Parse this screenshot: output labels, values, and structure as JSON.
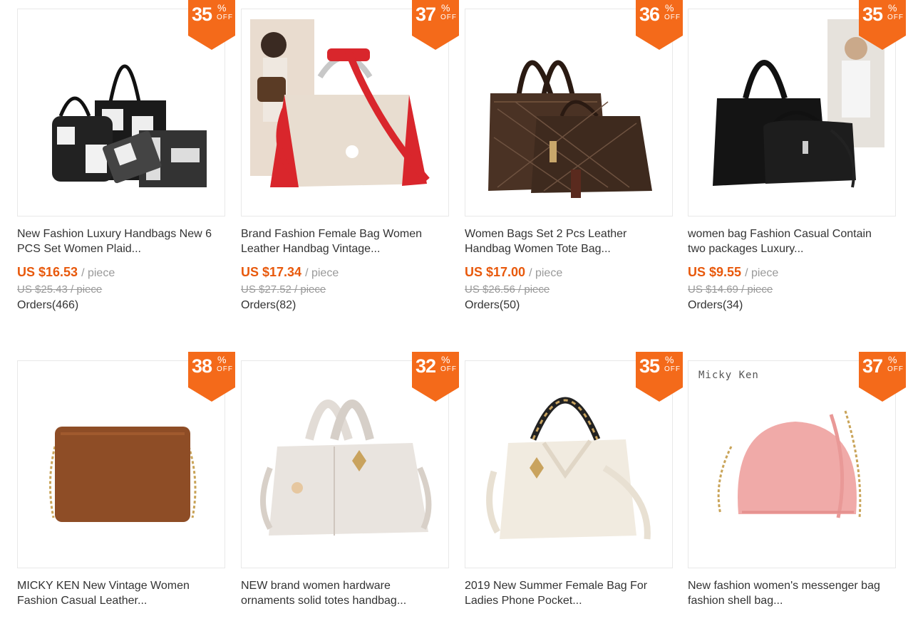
{
  "products": [
    {
      "discount": "35",
      "pct": "%",
      "off": "OFF",
      "title_l1": "New Fashion Luxury Handbags New 6",
      "title_l2": "PCS Set Women Plaid...",
      "price": "US $16.53",
      "unit": "/ piece",
      "orig": "US $25.43 / piece",
      "orders": "Orders(466)"
    },
    {
      "discount": "37",
      "pct": "%",
      "off": "OFF",
      "title_l1": "Brand Fashion Female Bag Women",
      "title_l2": "Leather Handbag Vintage...",
      "price": "US $17.34",
      "unit": "/ piece",
      "orig": "US $27.52 / piece",
      "orders": "Orders(82)"
    },
    {
      "discount": "36",
      "pct": "%",
      "off": "OFF",
      "title_l1": "Women Bags Set 2 Pcs Leather",
      "title_l2": "Handbag Women Tote Bag...",
      "price": "US $17.00",
      "unit": "/ piece",
      "orig": "US $26.56 / piece",
      "orders": "Orders(50)"
    },
    {
      "discount": "35",
      "pct": "%",
      "off": "OFF",
      "title_l1": "women bag Fashion Casual Contain",
      "title_l2": "two packages Luxury...",
      "price": "US $9.55",
      "unit": "/ piece",
      "orig": "US $14.69 / piece",
      "orders": "Orders(34)"
    },
    {
      "discount": "38",
      "pct": "%",
      "off": "OFF",
      "title_l1": "MICKY KEN New Vintage Women",
      "title_l2": "Fashion Casual Leather..."
    },
    {
      "discount": "32",
      "pct": "%",
      "off": "OFF",
      "title_l1": "NEW brand women hardware",
      "title_l2": "ornaments solid totes handbag..."
    },
    {
      "discount": "35",
      "pct": "%",
      "off": "OFF",
      "title_l1": "2019 New Summer Female Bag For",
      "title_l2": "Ladies Phone Pocket..."
    },
    {
      "discount": "37",
      "pct": "%",
      "off": "OFF",
      "title_l1": "New fashion women's messenger bag",
      "title_l2": "fashion shell bag...",
      "brand_mark": "Micky Ken"
    }
  ],
  "colors": {
    "accent": "#e8590c",
    "badge": "#f46a1a",
    "muted": "#999999"
  }
}
